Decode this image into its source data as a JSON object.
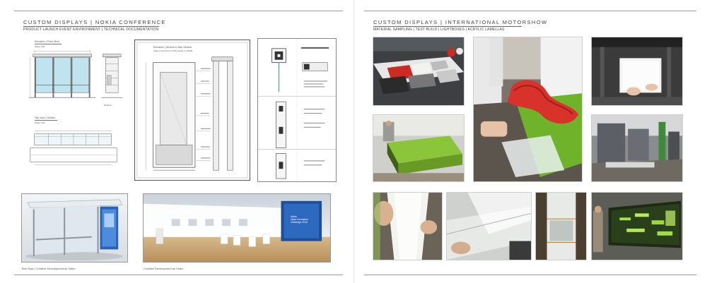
{
  "left_page": {
    "title": "CUSTOM DISPLAYS  |  NOKIA CONFERENCE",
    "subtitle": "PRODUCT LAUNCH EVENT ENVIRONMENT  |  TECHNICAL DOCUMENTATION",
    "drawings": {
      "front_elevation": {
        "title": "Elevation | Front View",
        "scale": "Scale 1:50"
      },
      "top_view": {
        "title": "Top View | Section",
        "scale": "Scale 1:50"
      },
      "side_section": {
        "title": "Elevation | Section & Side Section",
        "note": "Clear Connector by NCF panels or details"
      },
      "side_detail_note": "Detail A"
    },
    "renders": {
      "bus_stop": {
        "caption": "Bus Stop  |  Creative Development as Video"
      },
      "stand": {
        "caption": "Creative Development as Video",
        "screen_lines": [
          "Nokia",
          "Open Innovation",
          "Challenge 2016"
        ]
      }
    }
  },
  "right_page": {
    "title": "CUSTOM DISPLAYS  |  INTERNATIONAL MOTORSHOW",
    "subtitle": "MATERIAL SAMPLING  |  TEST BUILD  |  LIGHTBOXES  |  ACRYLIC LAMELLAS"
  },
  "colors": {
    "accent_green": "#7dc12b",
    "brand_red": "#d8322a",
    "nokia_blue": "#1e5aa8"
  }
}
